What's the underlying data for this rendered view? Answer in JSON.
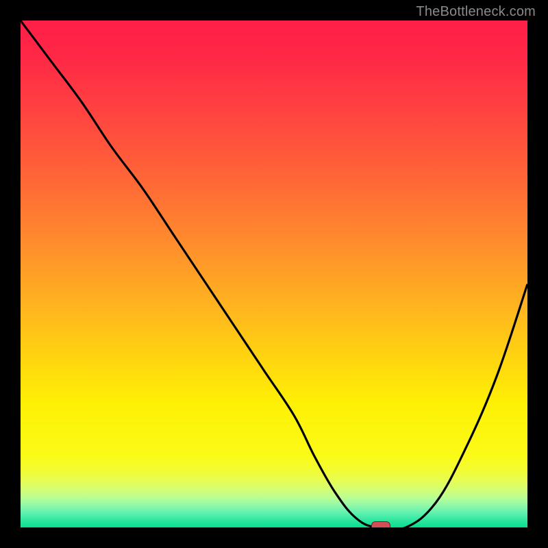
{
  "watermark": "TheBottleneck.com",
  "chart_data": {
    "type": "line",
    "title": "",
    "xlabel": "",
    "ylabel": "",
    "xlim": [
      0,
      100
    ],
    "ylim": [
      0,
      100
    ],
    "grid": false,
    "series": [
      {
        "name": "bottleneck-curve",
        "x": [
          0,
          6,
          12,
          18,
          24,
          30,
          36,
          42,
          48,
          54,
          58,
          62,
          66,
          70,
          76,
          82,
          88,
          94,
          100
        ],
        "y": [
          100,
          92,
          84,
          75,
          67,
          58,
          49,
          40,
          31,
          22,
          14,
          7,
          2,
          0,
          0,
          5,
          16,
          30,
          48
        ]
      }
    ],
    "marker": {
      "x": 71,
      "y": 0,
      "color": "#d54d55",
      "shape": "pill"
    },
    "background": {
      "type": "vertical-gradient",
      "stops": [
        {
          "color": "#ff1f48",
          "pos": 0
        },
        {
          "color": "#ff8f2c",
          "pos": 45
        },
        {
          "color": "#ffd60f",
          "pos": 70
        },
        {
          "color": "#fbfb18",
          "pos": 86
        },
        {
          "color": "#06df8d",
          "pos": 100
        }
      ]
    }
  }
}
